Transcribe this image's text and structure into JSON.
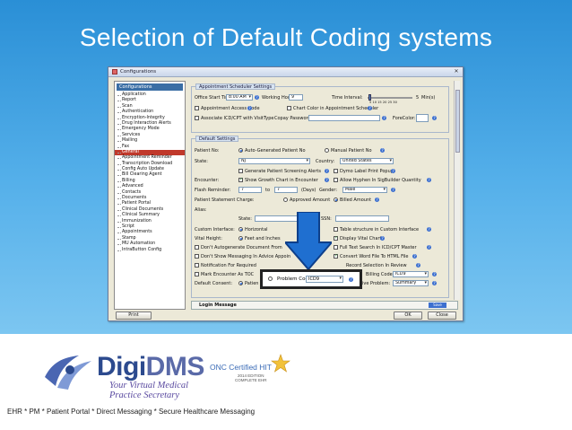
{
  "slide": {
    "title": "Selection of Default Coding systems",
    "footer_text": "EHR * PM * Patient Portal * Direct Messaging * Secure Healthcare Messaging",
    "logo": {
      "word_a": "Digi",
      "word_b": "DMS",
      "tagline_1": "Your Virtual Medical",
      "tagline_2": "Practice Secretary"
    },
    "onc": {
      "title": "ONC Certified HIT",
      "sub1": "2014 EDITION",
      "sub2": "COMPLETE EHR"
    }
  },
  "window": {
    "title": "Configurations",
    "tree_header": "Configurations",
    "tree_items": [
      "Application",
      "Report",
      "Scan",
      "Authentication",
      "Encryption-Integrity",
      "Drug Interaction Alerts",
      "Emergency Mode",
      "Services",
      "Mailing",
      "Fax",
      "General",
      "Appointment Reminder",
      "Transcription Download",
      "Config Auto Update",
      "Bill Clearing Agent",
      "Billing",
      "Advanced",
      "Contacts",
      "Documents",
      "Patient Portal",
      "Clinical Documents",
      "Clinical Summary",
      "Immunization",
      "Script",
      "Appointments",
      "Stamp",
      "MU Automation",
      "IntraButton Config"
    ],
    "selected_index": 10,
    "appt": {
      "group_title": "Appointment Scheduler Settings",
      "office_start_label": "Office Start Time:",
      "office_start_value": "8:00 AM",
      "working_hours_label": "Working Hours:",
      "working_hours_value": "9",
      "time_interval_label": "Time Interval:",
      "time_interval_value": "5",
      "time_interval_unit": "Min(s)",
      "ticks": "5  10  15  20  25  30",
      "access_code_label": "Appointment Access Code",
      "chart_color_label": "Chart Color in Appointment Scheduler",
      "associate_label": "Associate ICD/CPT with VisitType",
      "copay_label": "Copay Password:",
      "forecolor_label": "ForeColor:"
    },
    "defaults": {
      "group_title": "Default Settings",
      "patient_no_label": "Patient No:",
      "auto_gen_label": "Auto-Generated Patient No",
      "manual_label": "Manual Patient No",
      "state_label": "State:",
      "state_value": "NJ",
      "country_label": "Country:",
      "country_value": "United States",
      "gen_alerts_label": "Generate Patient Screening Alerts",
      "dymo_label": "Dymo Label Print Popup",
      "encounter_label": "Encounter:",
      "growth_label": "Show Growth Chart in Encounter",
      "hyphen_label": "Allow Hyphen In SigBuilder Quantity",
      "flash_label": "Flash Reminder:",
      "flash_from": "7",
      "flash_to_label": "to",
      "flash_to": "7",
      "days_label": "(Days)",
      "gender_label": "Gender:",
      "gender_value": "Male",
      "stmt_label": "Patient Statement Charge:",
      "approved_label": "Approved Amount",
      "billed_label": "Billed Amount",
      "alias_label": "Alias:",
      "alias_state_label": "State:",
      "ssn_label": "SSN:",
      "custom_iface_label": "Custom Interface:",
      "horizontal_label": "Horizontal",
      "table_struct_label": "Table structure in Custom Interface",
      "vital_height_label": "Vital Height:",
      "feet_label": "Feet and Inches",
      "display_vital_label": "Display Vital Chart",
      "dont_auto_label": "Don't Autogenerate Document From",
      "full_text_label": "Full Text Search In ICD/CPT Master",
      "dont_show_label": "Don't Show Messaging In Advice Appoin",
      "convert_word_label": "Convert Word File To HTML File",
      "notif_label": "Notification For Required",
      "record_sel_label": "Record Selection In Review",
      "mark_enc_label": "Mark Encounter As TOC",
      "problem_code_label": "Problem Code:",
      "problem_code_value": "ICD9",
      "billing_code_label": "Billing Code:",
      "billing_code_value": "ICD9",
      "default_consent_label": "Default Consent:",
      "patient_opt_label": "Patien",
      "inactive_label": "Active Problem:",
      "inactive_value": "Summary"
    },
    "login_label": "Login Message",
    "save_label": "Save",
    "print_label": "Print",
    "ok_label": "OK",
    "close_label": "Close"
  }
}
